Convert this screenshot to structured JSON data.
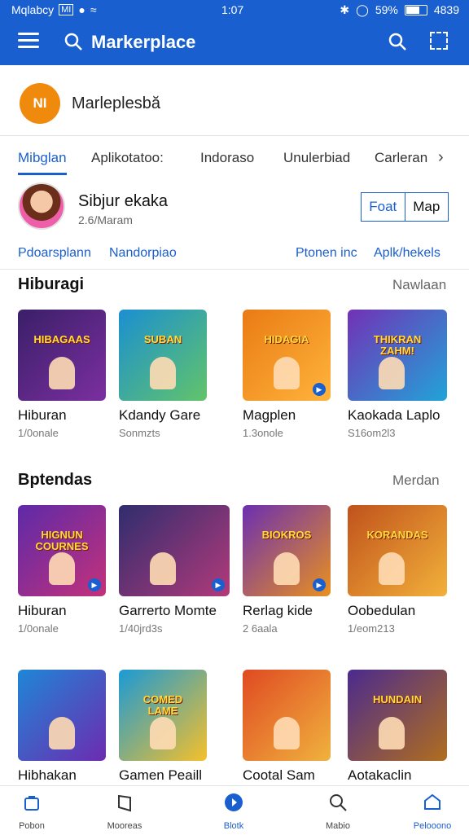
{
  "status_bar": {
    "carrier": "Mqlabcy",
    "network_tag": "MI",
    "time": "1:07",
    "battery_text": "59%",
    "extra": "4839"
  },
  "app_bar": {
    "title": "Markerplace"
  },
  "store": {
    "logo_text": "NI",
    "name": "Marleplesbă"
  },
  "tabs": [
    {
      "label": "Mibglan",
      "active": true
    },
    {
      "label": "Aplikotatoo:",
      "active": false
    },
    {
      "label": "Indoraso",
      "active": false
    },
    {
      "label": "Unulerbiad",
      "active": false
    },
    {
      "label": "Carleran",
      "active": false
    }
  ],
  "profile": {
    "name": "Sibjur ekaka",
    "sub": "2.6/Maram",
    "seg_left": "Foat",
    "seg_right": "Map"
  },
  "links": [
    "Pdoarsplann",
    "Nandorpiao",
    "Ptonen inc",
    "Aplk/hekels"
  ],
  "sections": [
    {
      "title": "Hiburagi",
      "more": "Nawlaan",
      "cards": [
        {
          "name": "Hiburan",
          "sub": "1/0onale",
          "art": "HIBAGAAS",
          "color": "#3a1f68",
          "color2": "#7b2fa0"
        },
        {
          "name": "Kdandy Gare",
          "sub": "Sonmzts",
          "art": "SUBAN",
          "color": "#1b8fd1",
          "color2": "#62c46a"
        },
        {
          "name": "Magplen",
          "sub": "1.3onole",
          "art": "HIDAGIA",
          "color": "#e97b14",
          "color2": "#ffb43c"
        },
        {
          "name": "Kaokada Laplo",
          "sub": "S16om2l3",
          "art": "THIKRAN ZAHM!",
          "color": "#7231b6",
          "color2": "#21a4d8"
        }
      ]
    },
    {
      "title": "Bptendas",
      "more": "Merdan",
      "cards": [
        {
          "name": "Hiburan",
          "sub": "1/0onale",
          "art": "HIGNUN COURNES",
          "color": "#5d2aa8",
          "color2": "#c4317a"
        },
        {
          "name": "Garrerto Momte",
          "sub": "1/40jrd3s",
          "art": "",
          "color": "#2f2d6e",
          "color2": "#b23a7a"
        },
        {
          "name": "Rerlag kide",
          "sub": "2 6aala",
          "art": "BIOKROS",
          "color": "#6b2fb1",
          "color2": "#e9901f"
        },
        {
          "name": "Oobedulan",
          "sub": "1/eom213",
          "art": "KORANDAS",
          "color": "#c0521c",
          "color2": "#f2b13a"
        }
      ]
    },
    {
      "title": "",
      "more": "",
      "cards": [
        {
          "name": "Hibhakan",
          "sub": "",
          "art": "",
          "color": "#1f86d6",
          "color2": "#6d2bb0"
        },
        {
          "name": "Gamen Peaill",
          "sub": "",
          "art": "COMED LAME",
          "color": "#1a9ad6",
          "color2": "#f6c02a"
        },
        {
          "name": "Cootal Sam",
          "sub": "",
          "art": "",
          "color": "#e04a22",
          "color2": "#f0b23e"
        },
        {
          "name": "Aotakaclin",
          "sub": "",
          "art": "HUNDAIN",
          "color": "#4b2a8e",
          "color2": "#b06e1e"
        }
      ]
    }
  ],
  "bottom_nav": [
    {
      "label": "Pobon",
      "icon": "bag-icon",
      "active": false
    },
    {
      "label": "Mooreas",
      "icon": "bookmark-icon",
      "active": false
    },
    {
      "label": "Blotk",
      "icon": "store-icon",
      "active": false
    },
    {
      "label": "Mabio",
      "icon": "search-icon",
      "active": false
    },
    {
      "label": "Pelooono",
      "icon": "home-icon",
      "active": true
    }
  ],
  "colors": {
    "primary": "#1a5fcf",
    "logo": "#f08a0c"
  }
}
